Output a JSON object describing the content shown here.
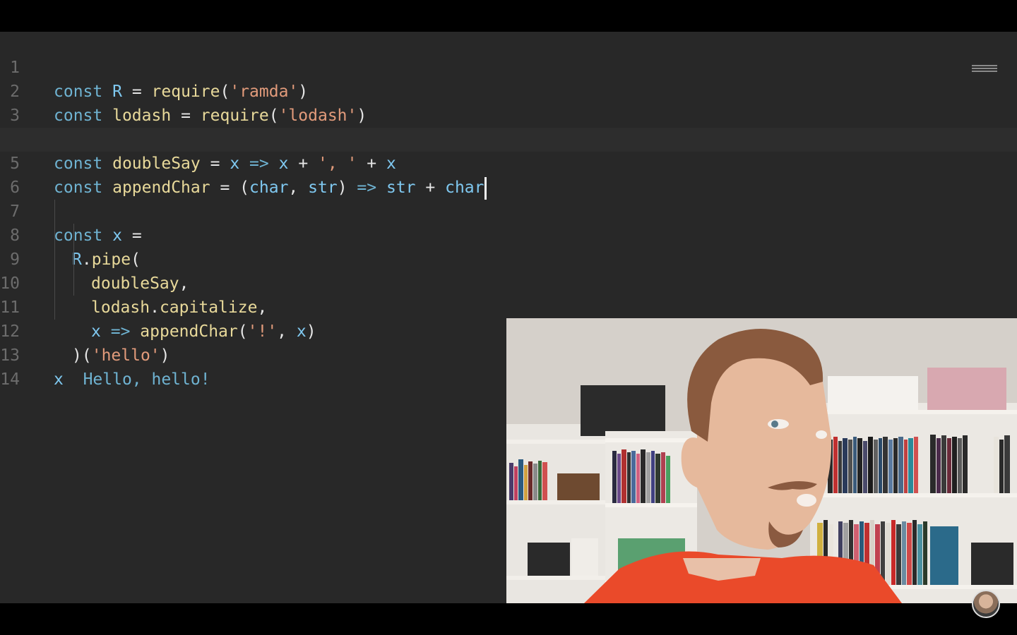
{
  "editor": {
    "line_numbers": [
      "1",
      "2",
      "3",
      "4",
      "5",
      "6",
      "7",
      "8",
      "9",
      "10",
      "11",
      "12",
      "13",
      "14"
    ],
    "lines": {
      "l1": {
        "kw": "const",
        "name": "R",
        "eq": "=",
        "fn": "require",
        "open": "(",
        "str": "'ramda'",
        "close": ")"
      },
      "l2": {
        "kw": "const",
        "name": "lodash",
        "eq": "=",
        "fn": "require",
        "open": "(",
        "str": "'lodash'",
        "close": ")"
      },
      "l4": {
        "kw": "const",
        "name": "doubleSay",
        "eq": "=",
        "p1": "x",
        "arrow": "=>",
        "p2": "x",
        "plus1": "+",
        "str": "', '",
        "plus2": "+",
        "p3": "x"
      },
      "l5": {
        "kw": "const",
        "name": "appendChar",
        "eq": "=",
        "open": "(",
        "a1": "char",
        "comma": ",",
        "a2": "str",
        "close": ")",
        "arrow": "=>",
        "b1": "str",
        "plus": "+",
        "b2": "char"
      },
      "l7": {
        "kw": "const",
        "name": "x",
        "eq": "="
      },
      "l8": {
        "obj": "R",
        "dot": ".",
        "fn": "pipe",
        "open": "("
      },
      "l9": {
        "fn": "doubleSay",
        "comma": ","
      },
      "l10": {
        "obj": "lodash",
        "dot": ".",
        "fn": "capitalize",
        "comma": ","
      },
      "l11": {
        "p": "x",
        "arrow": "=>",
        "fn": "appendChar",
        "open": "(",
        "str": "'!'",
        "comma": ",",
        "arg": "x",
        "close": ")"
      },
      "l12": {
        "close": ")",
        "open": "(",
        "str": "'hello'",
        "close2": ")"
      },
      "l13": {
        "marker": "x",
        "result": "Hello, hello!"
      }
    }
  },
  "overlay": {
    "webcam": "presenter-webcam",
    "channel_avatar": "avatar-icon"
  },
  "colors": {
    "background": "#282828",
    "keyword": "#6fb3d2",
    "function": "#e8d99a",
    "string": "#e29b7b",
    "identifier": "#7fc8f0"
  }
}
